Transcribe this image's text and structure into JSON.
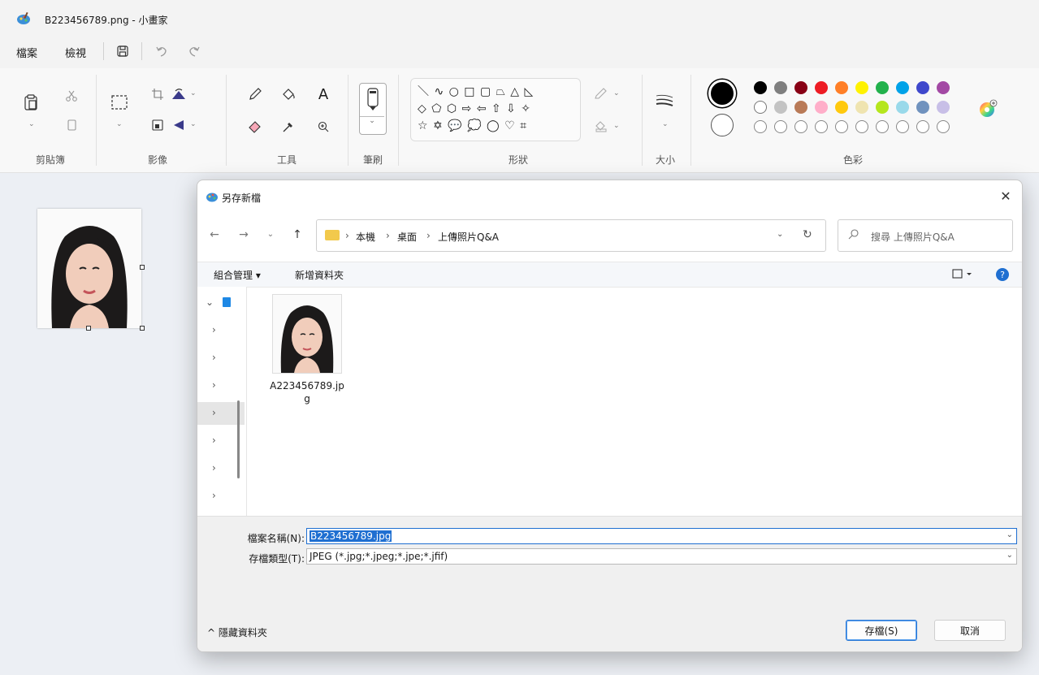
{
  "window": {
    "title": "B223456789.png - 小畫家"
  },
  "menu": {
    "file": "檔案",
    "view": "檢視"
  },
  "ribbon": {
    "groups": {
      "clipboard": "剪貼簿",
      "image": "影像",
      "tools": "工具",
      "brush": "筆刷",
      "shapes": "形狀",
      "size": "大小",
      "colors": "色彩"
    },
    "shape_glyphs": [
      "＼ ∿ ○ □ ▢ ⏢ △ ◺",
      "◇ ⬠ ⬡ ⇨ ⇦ ⇧ ⇩ ✧",
      "☆ ✡ 💬 💭 ◯ ♡ ⌗"
    ],
    "colors_row1": [
      "#000000",
      "#7f7f7f",
      "#880015",
      "#ed1c24",
      "#ff7f27",
      "#fff200",
      "#22b14c",
      "#00a2e8",
      "#3f48cc",
      "#a349a4"
    ],
    "colors_row2": [
      "#ffffff",
      "#c3c3c3",
      "#b97a57",
      "#ffaec9",
      "#ffc90e",
      "#efe4b0",
      "#b5e61d",
      "#99d9ea",
      "#7092be",
      "#c8bfe7"
    ]
  },
  "dialog": {
    "title": "另存新檔",
    "close_glyph": "✕",
    "breadcrumb": [
      "本機",
      "桌面",
      "上傳照片Q&A"
    ],
    "search_placeholder": "搜尋 上傳照片Q&A",
    "organize": "組合管理 ▾",
    "new_folder": "新增資料夾",
    "files": [
      {
        "name": "A223456789.jpg"
      }
    ],
    "filename_label": "檔案名稱(N):",
    "filename_value": "B223456789.jpg",
    "filetype_label": "存檔類型(T):",
    "filetype_value": "JPEG (*.jpg;*.jpeg;*.jpe;*.jfif)",
    "hide_folders": "隱藏資料夾",
    "save": "存檔(S)",
    "cancel": "取消"
  }
}
